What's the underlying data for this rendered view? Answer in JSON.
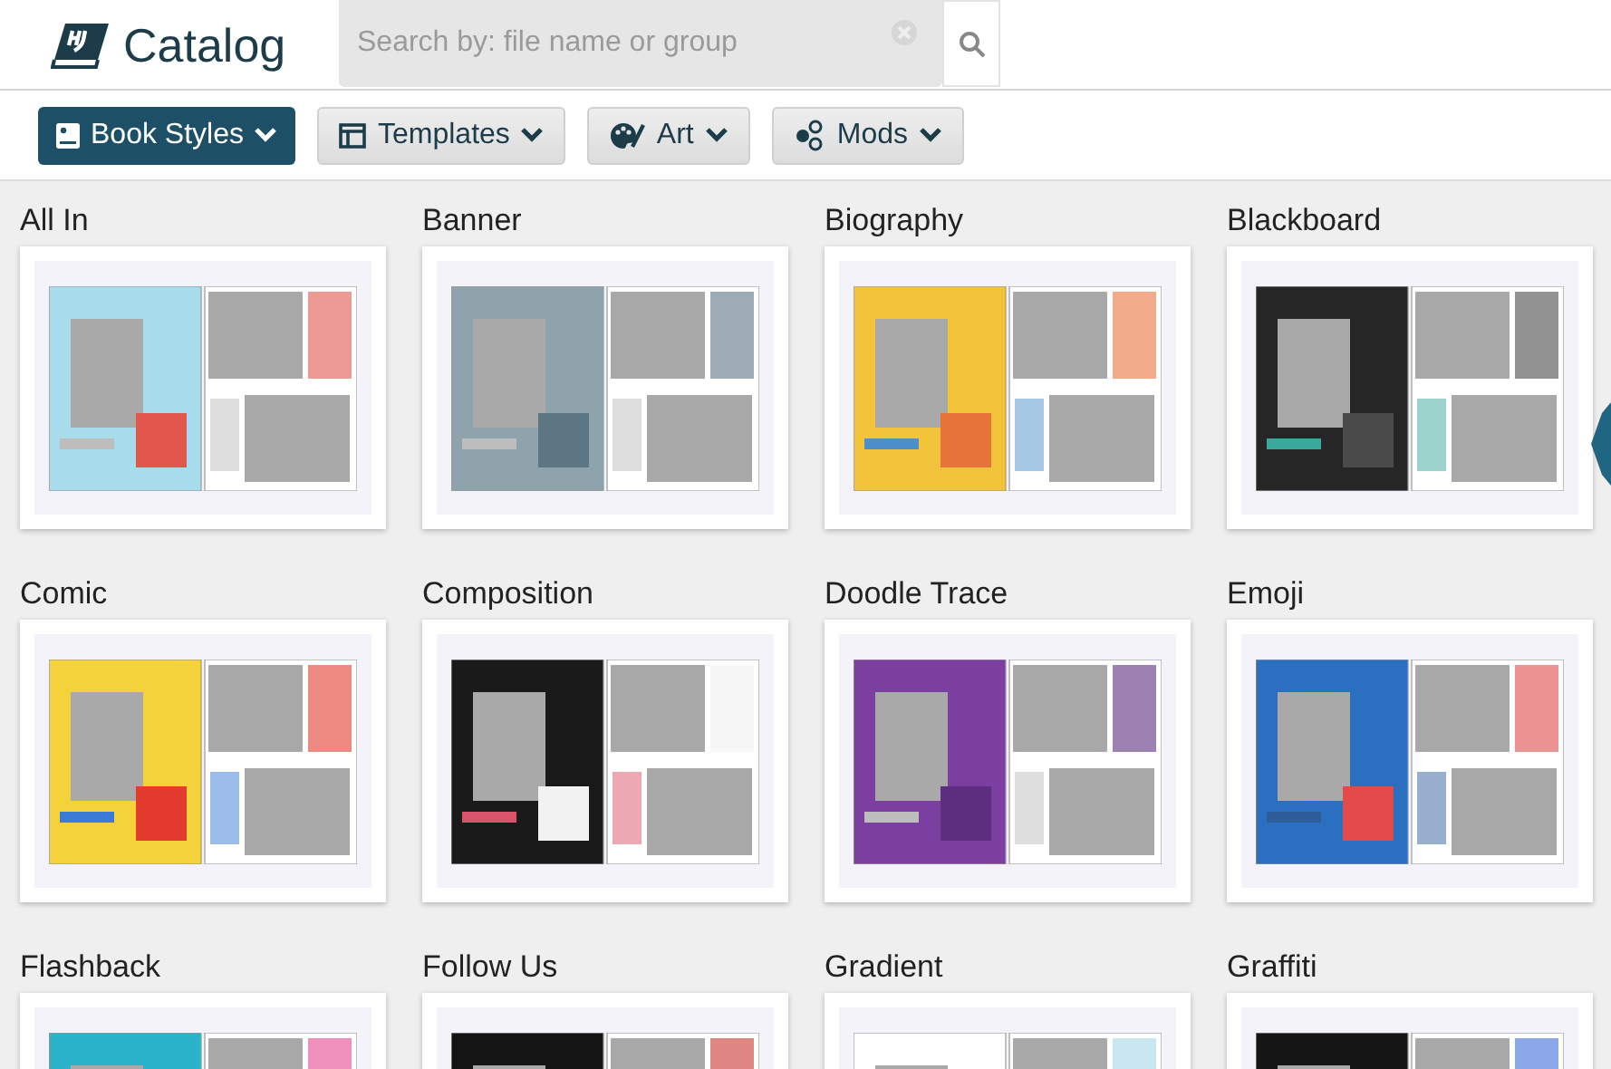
{
  "header": {
    "title": "Catalog",
    "search": {
      "placeholder": "Search by: file name or group"
    }
  },
  "toolbar": [
    {
      "label": "Book Styles",
      "selected": true
    },
    {
      "label": "Templates",
      "selected": false
    },
    {
      "label": "Art",
      "selected": false
    },
    {
      "label": "Mods",
      "selected": false
    }
  ],
  "catalog": [
    {
      "title": "All In"
    },
    {
      "title": "Banner"
    },
    {
      "title": "Biography"
    },
    {
      "title": "Blackboard"
    },
    {
      "title": "Comic"
    },
    {
      "title": "Composition"
    },
    {
      "title": "Doodle Trace"
    },
    {
      "title": "Emoji"
    },
    {
      "title": "Flashback"
    },
    {
      "title": "Follow Us"
    },
    {
      "title": "Gradient"
    },
    {
      "title": "Graffiti"
    }
  ]
}
